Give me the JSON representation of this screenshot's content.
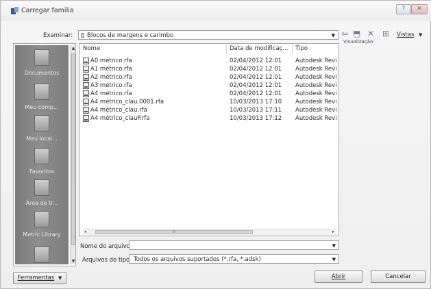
{
  "window": {
    "title": "Carregar família",
    "help_label": "?",
    "close_label": "✕"
  },
  "look_in": {
    "label": "Examinar:",
    "value": "Blocos de margens e carimbo",
    "arrow": "▼"
  },
  "toolbar": {
    "back_icon": "⇦",
    "up_icon": "⬒",
    "delete_icon": "✕",
    "views_icon": "⊞",
    "views_label": "Vistas",
    "views_arrow": "▼",
    "preview_label": "Visualização"
  },
  "places": [
    {
      "label": "Documentos",
      "icon": "documents-icon"
    },
    {
      "label": "Meu comp...",
      "icon": "computer-icon"
    },
    {
      "label": "Meu local...",
      "icon": "network-icon"
    },
    {
      "label": "Favoritos",
      "icon": "favorites-icon"
    },
    {
      "label": "Área de tr...",
      "icon": "desktop-icon"
    },
    {
      "label": "Metric Library",
      "icon": "library-icon"
    }
  ],
  "file_list": {
    "columns": [
      "Nome",
      "Data de modificaç...",
      "Tipo"
    ],
    "rows": [
      {
        "name": "A0 métrico.rfa",
        "date": "02/04/2012 12:01",
        "type": "Autodesk Revi"
      },
      {
        "name": "A1 métrico.rfa",
        "date": "02/04/2012 12:01",
        "type": "Autodesk Revi"
      },
      {
        "name": "A2 métrico.rfa",
        "date": "02/04/2012 12:01",
        "type": "Autodesk Revi"
      },
      {
        "name": "A3 métrico.rfa",
        "date": "02/04/2012 12:01",
        "type": "Autodesk Revi"
      },
      {
        "name": "A4 métrico.rfa",
        "date": "02/04/2012 12:01",
        "type": "Autodesk Revi"
      },
      {
        "name": "A4 métrico_clau.0001.rfa",
        "date": "10/03/2013 17:10",
        "type": "Autodesk Revi"
      },
      {
        "name": "A4 métrico_clau.rfa",
        "date": "10/03/2013 17:11",
        "type": "Autodesk Revi"
      },
      {
        "name": "A4 métrico_clauP.rfa",
        "date": "10/03/2013 17:12",
        "type": "Autodesk Revi"
      }
    ],
    "hscroll_grip": "III"
  },
  "filename": {
    "label": "Nome do arquivo:",
    "value": "",
    "arrow": "▼"
  },
  "filetype": {
    "label": "Arquivos do tipo:",
    "value": "Todos os arquivos suportados  (*.rfa, *.adsk)",
    "arrow": "▼"
  },
  "buttons": {
    "tools": "Ferramentas",
    "tools_arrow": "▼",
    "open": "Abrir",
    "cancel": "Cancelar"
  },
  "colors": {
    "accent": "#4a6a8a",
    "places_bg": "#858585"
  }
}
